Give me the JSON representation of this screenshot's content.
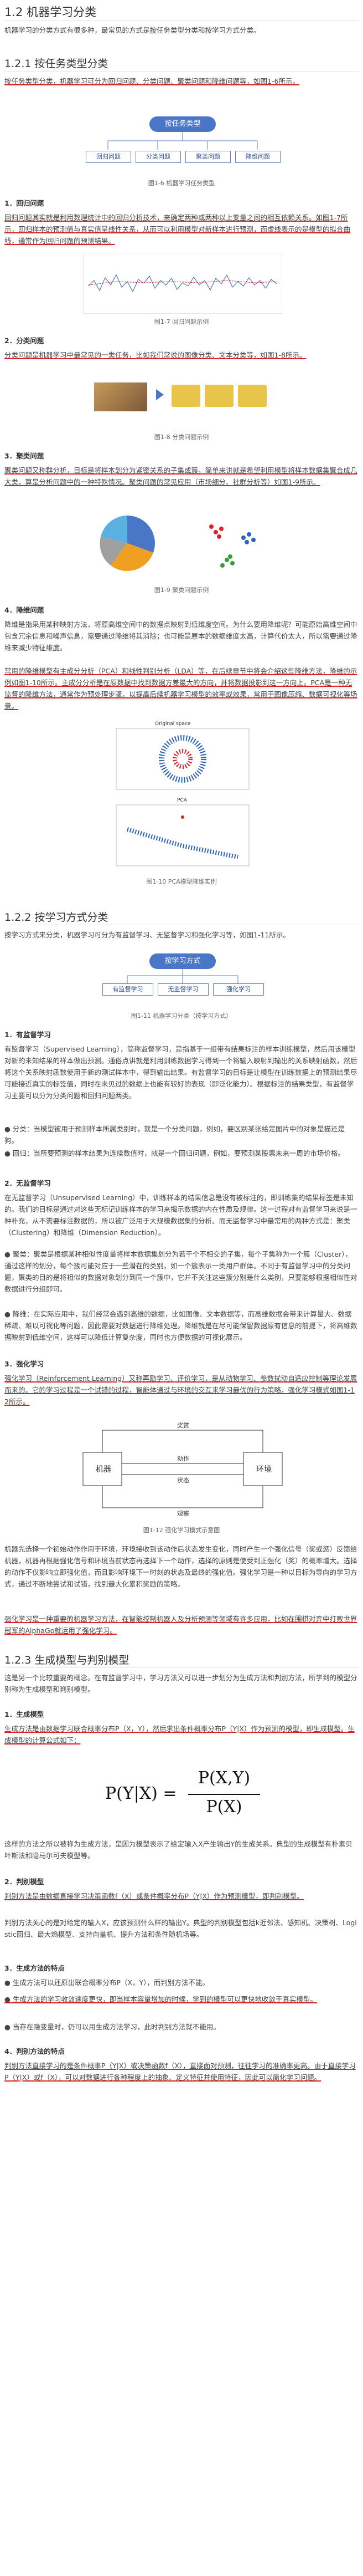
{
  "h1": "1.2 机器学习分类",
  "intro": "机器学习的分类方式有很多种，最常见的方式是按任务类型分类和按学习方式分类。",
  "s121": {
    "title": "1.2.1 按任务类型分类",
    "p1": "按任务类型分类，机器学习可分为回归问题、分类问题、聚类问题和降维问题等，如图1-6所示。",
    "fig_root": "按任务类型",
    "fig_items": [
      "回归问题",
      "分类问题",
      "聚类问题",
      "降维问题"
    ],
    "fig_cap": "图1-6 机器学习任务类型",
    "r_title": "1．回归问题",
    "r_text": "回归问题其实就是利用数理统计中的回归分析技术，来确定两种或两种以上变量之间的相互依赖关系。如图1-7所示，回归样本的预测值与真实值呈线性关系，从而可以利用模型对新样本进行预测，而虚线表示的是模型的拟合曲线，通常作为回归问题的预测结果。",
    "r_cap": "图1-7 回归问题示例",
    "c_title": "2．分类问题",
    "c_text": "分类问题是机器学习中最常见的一类任务，比如我们常说的图像分类、文本分类等，如图1-8所示。",
    "c_cap": "图1-8 分类问题示例",
    "k_title": "3．聚类问题",
    "k_text": "聚类问题又称群分析，目标是将样本划分为紧密关系的子集或簇，简单来讲就是希望利用模型将样本数据集聚合成几大类，算是分析问题中的一种特殊情况。聚类问题的常见应用（市场细分、社群分析等）如图1-9所示。",
    "k_cap": "图1-9 聚类问题示例",
    "d_title": "4．降维问题",
    "d_text1": "降维是指采用某种映射方法，将原高维空间中的数据点映射到低维度空间。为什么要用降维呢？可能原始高维空间中包含冗余信息和噪声信息，需要通过降维将其消除；也可能是原本的数据维度太高，计算代价太大，所以需要通过降维来减少特征维度。",
    "d_text2": "常用的降维模型有主成分分析（PCA）和线性判别分析（LDA）等，在后续章节中将会介绍这些降维方法，降维的示例如图1-10所示。主成分分析是在原数据中找到数据方差最大的方向，并将数据投影到这一方向上。PCA是一种无监督的降维方法，通常作为预处理步骤，以提高后续机器学习模型的效率或效果，常用于图像压缩、数据可视化等场景。",
    "d_cap": "图1-10 PCA模型降维实例",
    "pca_label_top": "Original space",
    "pca_label_bottom": "PCA"
  },
  "s122": {
    "title": "1.2.2 按学习方式分类",
    "p1": "按学习方式来分类，机器学习可分为有监督学习、无监督学习和强化学习等，如图1-11所示。",
    "fig_root": "按学习方式",
    "fig_items": [
      "有监督学习",
      "无监督学习",
      "强化学习"
    ],
    "fig_cap": "图1-11 机器学习分类（按学习方式）",
    "sup_title": "1．有监督学习",
    "sup_text": "有监督学习（Supervised Learning），简称监督学习，是指基于一组带有结果标注的样本训练模型，然后用该模型对新的未知结果的样本做出预测。通俗点讲就是利用训练数据学习得到一个将输入映射到输出的关系映射函数，然后将这个关系映射函数使用于新的测试样本中，得到输出结果。有监督学习的目标是让模型在训练数据上的预测结果尽可能接近真实的标签值，同时在未见过的数据上也能有较好的表现（即泛化能力）。根据标注的结果类型，有监督学习主要可以分为分类问题和回归问题两类。",
    "sup_b1": "● 分类：当模型被用于预测样本所属类别时，就是一个分类问题，例如，要区别某张给定图片中的对象是猫还是狗。",
    "sup_b2": "● 回归：当所要预测的样本结果为连续数值时，就是一个回归问题，例如，要预测某股票未来一周的市场价格。",
    "uns_title": "2．无监督学习",
    "uns_text": "在无监督学习（Unsupervised Learning）中，训练样本的结果信息是没有被标注的，即训练集的结果标签是未知的。我们的目标是通过对这些无标记训练样本的学习来揭示数据的内在性质及规律。这一过程对有监督学习来说是一种补充，从不需要标注数据的，所以被广泛用于大规模数据集的分析。而无监督学习中最常用的两种方式是：聚类（Clustering）和降维（Dimension Reduction）。",
    "uns_b1": "● 聚类：聚类是根据某种相似性度量将样本数据集划分为若干个不相交的子集，每个子集称为一个簇（Cluster），通过这样的划分，每个簇可能对应于一些潜在的类别，如一个簇表示一类用户群体。不同于有监督学习中的分类问题，聚类的目的是将相似的数据对象划分到同一个簇中，它并不关注这些簇分别是什么类别，只要能够根据相似性对数据进行分组即可。",
    "uns_b2": "● 降维：在实际应用中，我们经常会遇到高维的数据，比如图像、文本数据等，而高维数据会带来计算量大、数据稀疏、难以可视化等问题，因此需要对数据进行降维处理。降维就是在尽可能保留数据原有信息的前提下，将高维数据映射到低维空间，这样可以降低计算复杂度，同时也方便数据的可视化展示。",
    "rl_title": "3．强化学习",
    "rl_text": "强化学习（Reinforcement Learning）又称再励学习、评价学习，是从动物学习、参数扰动自适应控制等理论发展而来的。它的学习过程是一个试错的过程，智能体通过与环境的交互来学习最优的行为策略，强化学习模式如图1-12所示。",
    "rl_fig": {
      "agent": "机器",
      "env": "环境",
      "reward": "奖赏",
      "action": "动作",
      "state": "状态",
      "observe": "观察"
    },
    "rl_cap": "图1-12 强化学习模式示意图",
    "rl_text2": "机器先选择一个初始动作作用于环境，环境接收到该动作后状态发生变化，同时产生一个强化信号（奖或惩）反馈给机器，机器再根据强化信号和环境当前状态再选择下一个动作，选择的原则是使受到正强化（奖）的概率增大。选择的动作不仅影响立即强化值，而且影响环境下一时刻的状态及最终的强化值。强化学习是一种以目标为导向的学习方式，通过不断地尝试和试错，找到最大化累积奖励的策略。",
    "rl_text3": "强化学习是一种重要的机器学习方法，在智能控制机器人及分析预测等领域有许多应用，比如在围棋对弈中打败世界冠军的AlphaGo就运用了强化学习。",
    "s123_title": "1.2.3 生成模型与判别模型",
    "s123_text": "这是另一个比较重要的概念。在有监督学习中，学习方法又可以进一步划分为生成方法和判别方法，所学到的模型分别称为生成模型和判别模型。",
    "gen_title": "1．生成模型",
    "gen_text": "生成方法是由数据学习联合概率分布P（X，Y），然后求出条件概率分布P（Y|X）作为预测的模型，即生成模型。生成模型的计算公式如下：",
    "formula_left": "P(Y|X) =",
    "formula_num": "P(X,Y)",
    "formula_den": "P(X)",
    "gen_text2": "这样的方法之所以被称为生成方法，是因为模型表示了给定输入X产生输出Y的生成关系。典型的生成模型有朴素贝叶斯法和隐马尔可夫模型等。",
    "dis_title": "2．判别模型",
    "dis_text": "判别方法是由数据直接学习决策函数f（X）或条件概率分布P（Y|X）作为预测模型，即判别模型。",
    "dis_text2": "判别方法关心的是对给定的输入X，应该预测什么样的输出Y。典型的判别模型包括k近邻法、感知机、决策树、Logistic回归、最大熵模型、支持向量机、提升方法和条件随机场等。",
    "gd_title": "3．生成方法的特点",
    "gd_b1": "● 生成方法可以还原出联合概率分布P（X，Y），而判别方法不能。",
    "gd_b2": "● 生成方法的学习收敛速度更快，即当样本容量增加的时候，学到的模型可以更快地收敛于真实模型。",
    "gd_b3": "● 当存在隐变量时，仍可以用生成方法学习，此时判别方法就不能用。",
    "dd_title": "4．判别方法的特点",
    "dd_text": "判别方法直接学习的是条件概率P（Y|X）或决策函数f（X），直接面对预测，往往学习的准确率更高。由于直接学习P（Y|X）或f（X），可以对数据进行各种程度上的抽象、定义特征并使用特征，因此可以简化学习问题。"
  }
}
